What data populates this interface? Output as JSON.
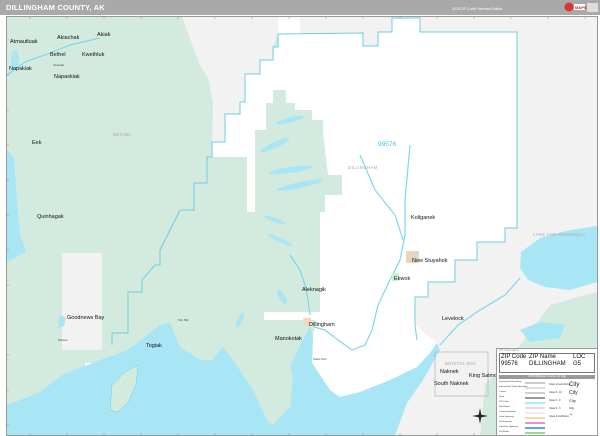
{
  "header": {
    "title": "DILLINGHAM COUNTY, AK",
    "edition": "2025 ZIP Code Premium Edition",
    "logo_text": "Market Maps"
  },
  "colors": {
    "water": "#a8e6f6",
    "refuge_green": "#d3eadf",
    "land_gray": "#f2f2f2",
    "county_white": "#ffffff",
    "boundary": "#6fcde3",
    "zip_label": "#3fc6ec"
  },
  "map": {
    "zip_label": "99576",
    "regions": {
      "bethel": "BETHEL",
      "dillingham": "DILLINGHAM",
      "lake_peninsula": "LAKE AND PENINSULA",
      "bristol_bay": "BRISTOL BAY"
    },
    "cities": [
      {
        "name": "Atmautluak"
      },
      {
        "name": "Akiachak"
      },
      {
        "name": "Akiak"
      },
      {
        "name": "Bethel"
      },
      {
        "name": "Kwethluk"
      },
      {
        "name": "Napakiak"
      },
      {
        "name": "Napaskiak"
      },
      {
        "name": "Eek"
      },
      {
        "name": "Quinhagak"
      },
      {
        "name": "Goodnews Bay"
      },
      {
        "name": "Togiak"
      },
      {
        "name": "Aleknagik"
      },
      {
        "name": "Dillingham"
      },
      {
        "name": "Manokotak"
      },
      {
        "name": "Koliganek"
      },
      {
        "name": "New Stuyahok"
      },
      {
        "name": "Ekwok"
      },
      {
        "name": "Levelock"
      },
      {
        "name": "Naknek"
      },
      {
        "name": "South Naknek"
      },
      {
        "name": "King Salmon"
      }
    ],
    "small_places": {
      "oscarville": "Oscarville",
      "platinum": "Platinum",
      "twin_hills": "Twin Hills",
      "clarks_point": "Clarks Point"
    }
  },
  "legend": {
    "caption": "ZIP Code Legend",
    "headers": [
      "ZIP Code",
      "ZIP Name",
      "LOC"
    ],
    "rows": [
      [
        "99576",
        "DILLINGHAM",
        "G5"
      ]
    ],
    "title": "2025 Dillingham County, AK Map",
    "items": [
      {
        "label": "International Boundary",
        "color": "#cccccc"
      },
      {
        "label": "International Water Boundary",
        "color": "#dddddd"
      },
      {
        "label": "County",
        "color": "#d0d0d0"
      },
      {
        "label": "State",
        "color": "#999999"
      },
      {
        "label": "ZIP Code",
        "color": "#a8ecf8"
      },
      {
        "label": "Rail Roads",
        "color": "#f4d6d6"
      },
      {
        "label": "County Highways",
        "color": "#eeeeee"
      },
      {
        "label": "State Highways",
        "color": "#f7d9a8"
      },
      {
        "label": "US Highways",
        "color": "#f58ac6"
      },
      {
        "label": "Interstate Highways",
        "color": "#5aa8e8"
      },
      {
        "label": "Toll Roads",
        "color": "#8ee08e"
      }
    ],
    "classes": [
      {
        "label": "Class 10 and Above",
        "sample": "City"
      },
      {
        "label": "Class 8 - 10",
        "sample": "City"
      },
      {
        "label": "Class 6 - 8",
        "sample": "City"
      },
      {
        "label": "Class 5 - 6",
        "sample": "City"
      },
      {
        "label": "Class 4 and Below",
        "sample": "City"
      }
    ]
  }
}
